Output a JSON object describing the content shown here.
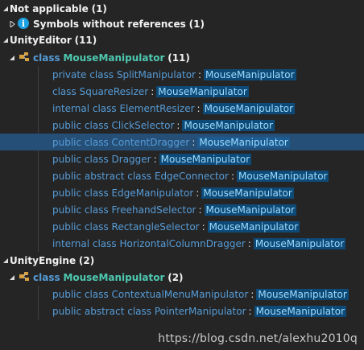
{
  "tree": {
    "not_applicable": {
      "label": "Not applicable",
      "count": "(1)"
    },
    "symbols_without_refs": {
      "label": "Symbols without references",
      "count": "(1)"
    },
    "unity_editor": {
      "label": "UnityEditor",
      "count": "(11)",
      "class_keyword": "class",
      "class_name": "MouseManipulator",
      "class_count": "(11)",
      "items": [
        {
          "prefix": "private class SplitManipulator",
          "base": "MouseManipulator"
        },
        {
          "prefix": "class SquareResizer",
          "base": "MouseManipulator"
        },
        {
          "prefix": "internal class ElementResizer",
          "base": "MouseManipulator"
        },
        {
          "prefix": "public class ClickSelector",
          "base": "MouseManipulator"
        },
        {
          "prefix": "public class ContentDragger",
          "base": "MouseManipulator",
          "selected": true
        },
        {
          "prefix": "public class Dragger",
          "base": "MouseManipulator"
        },
        {
          "prefix": "public abstract class EdgeConnector",
          "base": "MouseManipulator"
        },
        {
          "prefix": "public class EdgeManipulator",
          "base": "MouseManipulator"
        },
        {
          "prefix": "public class FreehandSelector",
          "base": "MouseManipulator"
        },
        {
          "prefix": "public class RectangleSelector",
          "base": "MouseManipulator"
        },
        {
          "prefix": "internal class HorizontalColumnDragger",
          "base": "MouseManipulator"
        }
      ]
    },
    "unity_engine": {
      "label": "UnityEngine",
      "count": "(2)",
      "class_keyword": "class",
      "class_name": "MouseManipulator",
      "class_count": "(2)",
      "items": [
        {
          "prefix": "public class ContextualMenuManipulator",
          "base": "MouseManipulator"
        },
        {
          "prefix": "public abstract class PointerManipulator",
          "base": "MouseManipulator"
        }
      ]
    }
  },
  "separator": ":",
  "watermark": "https://blog.csdn.net/alexhu2010q",
  "colors": {
    "background": "#252526",
    "selection": "#264f78",
    "keyword": "#569cd6",
    "type": "#4ec9b0",
    "highlight": "#0e4a77"
  }
}
